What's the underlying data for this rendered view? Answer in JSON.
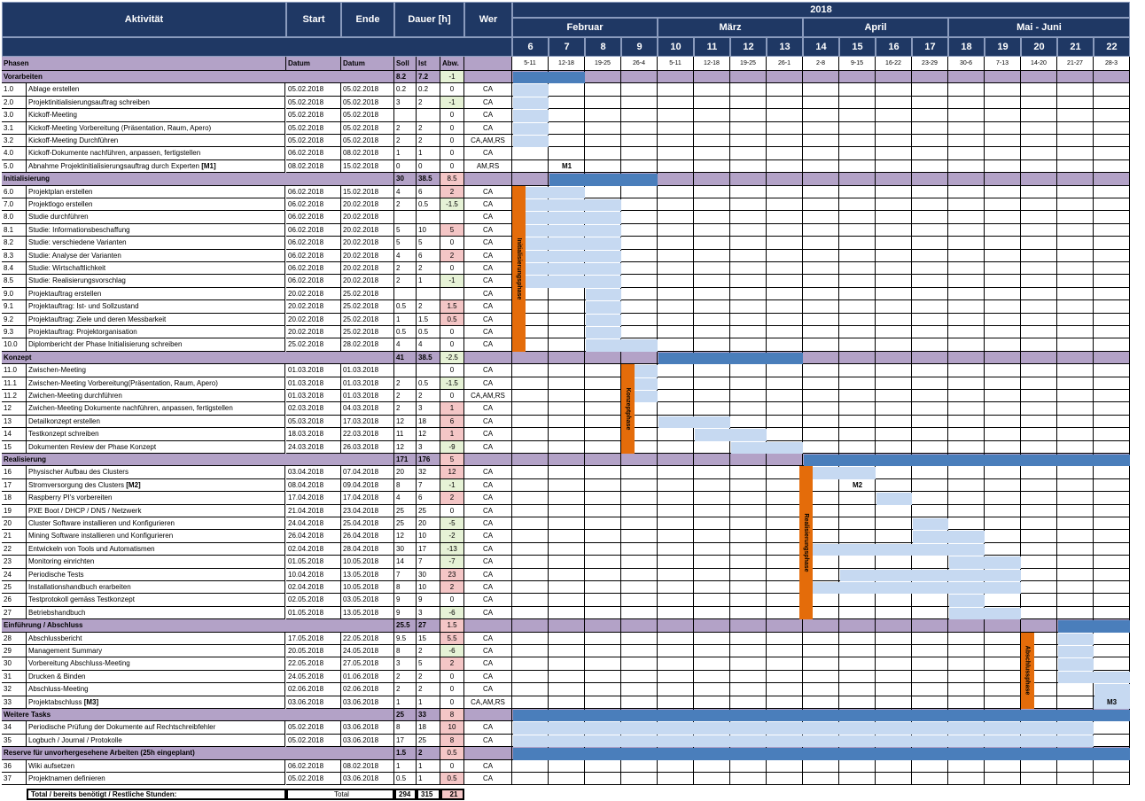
{
  "header": {
    "activity": "Aktivität",
    "start": "Start",
    "end": "Ende",
    "duration": "Dauer [h]",
    "who": "Wer",
    "year": "2018",
    "months": [
      {
        "label": "Februar",
        "start_week_index": 0,
        "span_weeks": 4
      },
      {
        "label": "März",
        "start_week_index": 4,
        "span_weeks": 4
      },
      {
        "label": "April",
        "start_week_index": 8,
        "span_weeks": 4
      },
      {
        "label": "Mai - Juni",
        "start_week_index": 12,
        "span_weeks": 5
      }
    ],
    "weeks": [
      "6",
      "7",
      "8",
      "9",
      "10",
      "11",
      "12",
      "13",
      "14",
      "15",
      "16",
      "17",
      "18",
      "19",
      "20",
      "21",
      "22"
    ],
    "ranges": [
      "5-11",
      "12-18",
      "19-25",
      "26-4",
      "5-11",
      "12-18",
      "19-25",
      "26-1",
      "2-8",
      "9-15",
      "16-22",
      "23-29",
      "30-6",
      "7-13",
      "14-20",
      "21-27",
      "28-3"
    ],
    "sub": {
      "phases": "Phasen",
      "datum": "Datum",
      "soll": "Soll",
      "ist": "Ist",
      "abw": "Abw."
    }
  },
  "colors": {
    "header_bg": "#1f3864",
    "phase_row": "#b3a2c7",
    "task_bar": "#c6d9f1",
    "phase_bar": "#4a7ebb",
    "phase_marker": "#e46c0a",
    "positive": "#e6f2d6",
    "negative": "#f4c6c6"
  },
  "rows": [
    {
      "kind": "phase",
      "name": "Vorarbeiten",
      "soll": "8.2",
      "ist": "7.2",
      "abw": "-1",
      "bar": [
        0,
        1
      ]
    },
    {
      "kind": "task",
      "no": "1.0",
      "name": "Ablage erstellen",
      "start": "05.02.2018",
      "end": "05.02.2018",
      "soll": "0.2",
      "ist": "0.2",
      "abw": "0",
      "who": "CA",
      "bar": [
        0,
        0
      ]
    },
    {
      "kind": "task",
      "no": "2.0",
      "name": "Projektinitialisierungsauftrag schreiben",
      "start": "05.02.2018",
      "end": "05.02.2018",
      "soll": "3",
      "ist": "2",
      "abw": "-1",
      "who": "CA",
      "bar": [
        0,
        0
      ]
    },
    {
      "kind": "task",
      "no": "3.0",
      "name": "Kickoff-Meeting",
      "start": "05.02.2018",
      "end": "05.02.2018",
      "soll": "",
      "ist": "",
      "abw": "0",
      "who": "CA",
      "bar": [
        0,
        0
      ]
    },
    {
      "kind": "task",
      "no": "3.1",
      "name": "Kickoff-Meeting Vorbereitung (Präsentation, Raum, Apero)",
      "start": "05.02.2018",
      "end": "05.02.2018",
      "soll": "2",
      "ist": "2",
      "abw": "0",
      "who": "CA",
      "bar": [
        0,
        0
      ]
    },
    {
      "kind": "task",
      "no": "3.2",
      "name": "Kickoff-Meeting Durchführen",
      "start": "05.02.2018",
      "end": "05.02.2018",
      "soll": "2",
      "ist": "2",
      "abw": "0",
      "who": "CA,AM,RS",
      "bar": [
        0,
        0
      ]
    },
    {
      "kind": "task",
      "no": "4.0",
      "name": "Kickoff-Dokumente nachführen, anpassen, fertigstellen",
      "start": "06.02.2018",
      "end": "08.02.2018",
      "soll": "1",
      "ist": "1",
      "abw": "0",
      "who": "CA"
    },
    {
      "kind": "task",
      "no": "5.0",
      "name": "Abnahme Projektinitialisierungsauftrag durch Experten",
      "tag": "[M1]",
      "start": "08.02.2018",
      "end": "15.02.2018",
      "soll": "0",
      "ist": "0",
      "abw": "0",
      "who": "AM,RS",
      "milestone": {
        "label": "M1",
        "week": 1
      }
    },
    {
      "kind": "phase",
      "name": "Initialisierung",
      "soll": "30",
      "ist": "38.5",
      "abw": "8.5",
      "bar": [
        1,
        3
      ]
    },
    {
      "kind": "task",
      "no": "6.0",
      "name": "Projektplan erstellen",
      "start": "06.02.2018",
      "end": "15.02.2018",
      "soll": "4",
      "ist": "6",
      "abw": "2",
      "who": "CA",
      "bar": [
        0,
        1
      ]
    },
    {
      "kind": "task",
      "no": "7.0",
      "name": "Projektlogo erstellen",
      "start": "06.02.2018",
      "end": "20.02.2018",
      "soll": "2",
      "ist": "0.5",
      "abw": "-1.5",
      "who": "CA",
      "bar": [
        0,
        2
      ]
    },
    {
      "kind": "task",
      "no": "8.0",
      "name": "Studie durchführen",
      "start": "06.02.2018",
      "end": "20.02.2018",
      "soll": "",
      "ist": "",
      "abw": "",
      "who": "CA",
      "bar": [
        0,
        2
      ]
    },
    {
      "kind": "task",
      "no": "8.1",
      "name": "Studie: Informationsbeschaffung",
      "start": "06.02.2018",
      "end": "20.02.2018",
      "soll": "5",
      "ist": "10",
      "abw": "5",
      "who": "CA",
      "bar": [
        0,
        2
      ]
    },
    {
      "kind": "task",
      "no": "8.2",
      "name": "Studie: verschiedene Varianten",
      "start": "06.02.2018",
      "end": "20.02.2018",
      "soll": "5",
      "ist": "5",
      "abw": "0",
      "who": "CA",
      "bar": [
        0,
        2
      ]
    },
    {
      "kind": "task",
      "no": "8.3",
      "name": "Studie: Analyse der Varianten",
      "start": "06.02.2018",
      "end": "20.02.2018",
      "soll": "4",
      "ist": "6",
      "abw": "2",
      "who": "CA",
      "bar": [
        0,
        2
      ]
    },
    {
      "kind": "task",
      "no": "8.4",
      "name": "Studie: Wirtschaftlichkeit",
      "start": "06.02.2018",
      "end": "20.02.2018",
      "soll": "2",
      "ist": "2",
      "abw": "0",
      "who": "CA",
      "bar": [
        0,
        2
      ]
    },
    {
      "kind": "task",
      "no": "8.5",
      "name": "Studie: Realisierungsvorschlag",
      "start": "06.02.2018",
      "end": "20.02.2018",
      "soll": "2",
      "ist": "1",
      "abw": "-1",
      "who": "CA",
      "bar": [
        0,
        2
      ]
    },
    {
      "kind": "task",
      "no": "9.0",
      "name": "Projektauftrag erstellen",
      "start": "20.02.2018",
      "end": "25.02.2018",
      "soll": "",
      "ist": "",
      "abw": "",
      "who": "CA",
      "bar": [
        2,
        2
      ]
    },
    {
      "kind": "task",
      "no": "9.1",
      "name": "Projektauftrag: Ist- und Sollzustand",
      "start": "20.02.2018",
      "end": "25.02.2018",
      "soll": "0.5",
      "ist": "2",
      "abw": "1.5",
      "who": "CA",
      "bar": [
        2,
        2
      ]
    },
    {
      "kind": "task",
      "no": "9.2",
      "name": "Projektauftrag: Ziele und deren Messbarkeit",
      "start": "20.02.2018",
      "end": "25.02.2018",
      "soll": "1",
      "ist": "1.5",
      "abw": "0.5",
      "who": "CA",
      "bar": [
        2,
        2
      ]
    },
    {
      "kind": "task",
      "no": "9.3",
      "name": "Projektauftrag: Projektorganisation",
      "start": "20.02.2018",
      "end": "25.02.2018",
      "soll": "0.5",
      "ist": "0.5",
      "abw": "0",
      "who": "CA",
      "bar": [
        2,
        2
      ]
    },
    {
      "kind": "task",
      "no": "10.0",
      "name": "Diplombericht der Phase Initialisierung schreiben",
      "start": "25.02.2018",
      "end": "28.02.2018",
      "soll": "4",
      "ist": "4",
      "abw": "0",
      "who": "CA",
      "bar": [
        2,
        3
      ]
    },
    {
      "kind": "phase",
      "name": "Konzept",
      "soll": "41",
      "ist": "38.5",
      "abw": "-2.5",
      "bar": [
        4,
        7
      ]
    },
    {
      "kind": "task",
      "no": "11.0",
      "name": "Zwischen-Meeting",
      "start": "01.03.2018",
      "end": "01.03.2018",
      "soll": "",
      "ist": "",
      "abw": "0",
      "who": "CA",
      "bar": [
        3,
        3
      ]
    },
    {
      "kind": "task",
      "no": "11.1",
      "name": "Zwischen-Meeting Vorbereitung(Präsentation, Raum, Apero)",
      "start": "01.03.2018",
      "end": "01.03.2018",
      "soll": "2",
      "ist": "0.5",
      "abw": "-1.5",
      "who": "CA",
      "bar": [
        3,
        3
      ]
    },
    {
      "kind": "task",
      "no": "11.2",
      "name": "Zwichen-Meeting durchführen",
      "start": "01.03.2018",
      "end": "01.03.2018",
      "soll": "2",
      "ist": "2",
      "abw": "0",
      "who": "CA,AM,RS",
      "bar": [
        3,
        3
      ]
    },
    {
      "kind": "task",
      "no": "12",
      "name": "Zwichen-Meeting Dokumente nachführen, anpassen, fertigstellen",
      "start": "02.03.2018",
      "end": "04.03.2018",
      "soll": "2",
      "ist": "3",
      "abw": "1",
      "who": "CA"
    },
    {
      "kind": "task",
      "no": "13",
      "name": "Detailkonzept erstellen",
      "start": "05.03.2018",
      "end": "17.03.2018",
      "soll": "12",
      "ist": "18",
      "abw": "6",
      "who": "CA",
      "bar": [
        4,
        5
      ]
    },
    {
      "kind": "task",
      "no": "14",
      "name": "Testkonzept schreiben",
      "start": "18.03.2018",
      "end": "22.03.2018",
      "soll": "11",
      "ist": "12",
      "abw": "1",
      "who": "CA",
      "bar": [
        5,
        6
      ]
    },
    {
      "kind": "task",
      "no": "15",
      "name": "Dokumenten Review der Phase Konzept",
      "start": "24.03.2018",
      "end": "26.03.2018",
      "soll": "12",
      "ist": "3",
      "abw": "-9",
      "who": "CA",
      "bar": [
        6,
        7
      ]
    },
    {
      "kind": "phase",
      "name": "Realisierung",
      "soll": "171",
      "ist": "176",
      "abw": "5",
      "bar": [
        8,
        16
      ]
    },
    {
      "kind": "task",
      "no": "16",
      "name": "Physischer Aufbau des Clusters",
      "start": "03.04.2018",
      "end": "07.04.2018",
      "soll": "20",
      "ist": "32",
      "abw": "12",
      "who": "CA",
      "bar": [
        8,
        9
      ]
    },
    {
      "kind": "task",
      "no": "17",
      "name": "Stromversorgung des Clusters",
      "tag": "[M2]",
      "start": "08.04.2018",
      "end": "09.04.2018",
      "soll": "8",
      "ist": "7",
      "abw": "-1",
      "who": "CA",
      "milestone": {
        "label": "M2",
        "week": 9
      }
    },
    {
      "kind": "task",
      "no": "18",
      "name": "Raspberry PI's vorbereiten",
      "start": "17.04.2018",
      "end": "17.04.2018",
      "soll": "4",
      "ist": "6",
      "abw": "2",
      "who": "CA",
      "bar": [
        10,
        10
      ]
    },
    {
      "kind": "task",
      "no": "19",
      "name": "PXE Boot / DHCP  / DNS / Netzwerk",
      "start": "21.04.2018",
      "end": "23.04.2018",
      "soll": "25",
      "ist": "25",
      "abw": "0",
      "who": "CA"
    },
    {
      "kind": "task",
      "no": "20",
      "name": "Cluster Software installieren und Konfigurieren",
      "start": "24.04.2018",
      "end": "25.04.2018",
      "soll": "25",
      "ist": "20",
      "abw": "-5",
      "who": "CA",
      "bar": [
        11,
        11
      ]
    },
    {
      "kind": "task",
      "no": "21",
      "name": "Mining Software installieren und Konfigurieren",
      "start": "26.04.2018",
      "end": "26.04.2018",
      "soll": "12",
      "ist": "10",
      "abw": "-2",
      "who": "CA",
      "bar": [
        11,
        12
      ]
    },
    {
      "kind": "task",
      "no": "22",
      "name": "Entwickeln von Tools und Automatismen",
      "start": "02.04.2018",
      "end": "28.04.2018",
      "soll": "30",
      "ist": "17",
      "abw": "-13",
      "who": "CA",
      "bar": [
        8,
        12
      ]
    },
    {
      "kind": "task",
      "no": "23",
      "name": "Monitoring einrichten",
      "start": "01.05.2018",
      "end": "10.05.2018",
      "soll": "14",
      "ist": "7",
      "abw": "-7",
      "who": "CA",
      "bar": [
        12,
        13
      ]
    },
    {
      "kind": "task",
      "no": "24",
      "name": "Periodische Tests",
      "start": "10.04.2018",
      "end": "13.05.2018",
      "soll": "7",
      "ist": "30",
      "abw": "23",
      "who": "CA",
      "bar": [
        9,
        13
      ]
    },
    {
      "kind": "task",
      "no": "25",
      "name": "Installationshandbuch erarbeiten",
      "start": "02.04.2018",
      "end": "10.05.2018",
      "soll": "8",
      "ist": "10",
      "abw": "2",
      "who": "CA",
      "bar": [
        8,
        13
      ]
    },
    {
      "kind": "task",
      "no": "26",
      "name": "Testprotokoll gemäss Testkonzept",
      "start": "02.05.2018",
      "end": "03.05.2018",
      "soll": "9",
      "ist": "9",
      "abw": "0",
      "who": "CA",
      "bar": [
        12,
        12
      ]
    },
    {
      "kind": "task",
      "no": "27",
      "name": "Betriebshandbuch",
      "start": "01.05.2018",
      "end": "13.05.2018",
      "soll": "9",
      "ist": "3",
      "abw": "-6",
      "who": "CA",
      "bar": [
        12,
        13
      ]
    },
    {
      "kind": "phase",
      "name": "Einführung / Abschluss",
      "soll": "25.5",
      "ist": "27",
      "abw": "1.5",
      "bar": [
        15,
        16
      ]
    },
    {
      "kind": "task",
      "no": "28",
      "name": "Abschlussbericht",
      "start": "17.05.2018",
      "end": "22.05.2018",
      "soll": "9.5",
      "ist": "15",
      "abw": "5.5",
      "who": "CA",
      "bar": [
        15,
        15
      ]
    },
    {
      "kind": "task",
      "no": "29",
      "name": "Management Summary",
      "start": "20.05.2018",
      "end": "24.05.2018",
      "soll": "8",
      "ist": "2",
      "abw": "-6",
      "who": "CA",
      "bar": [
        15,
        15
      ]
    },
    {
      "kind": "task",
      "no": "30",
      "name": "Vorbereitung Abschluss-Meeting",
      "start": "22.05.2018",
      "end": "27.05.2018",
      "soll": "3",
      "ist": "5",
      "abw": "2",
      "who": "CA",
      "bar": [
        15,
        15
      ]
    },
    {
      "kind": "task",
      "no": "31",
      "name": "Drucken & Binden",
      "start": "24.05.2018",
      "end": "01.06.2018",
      "soll": "2",
      "ist": "2",
      "abw": "0",
      "who": "CA",
      "bar": [
        15,
        16
      ]
    },
    {
      "kind": "task",
      "no": "32",
      "name": "Abschluss-Meeting",
      "start": "02.06.2018",
      "end": "02.06.2018",
      "soll": "2",
      "ist": "2",
      "abw": "0",
      "who": "CA",
      "bar": [
        16,
        16
      ]
    },
    {
      "kind": "task",
      "no": "33",
      "name": "Projektabschluss",
      "tag": "[M3]",
      "start": "03.06.2018",
      "end": "03.06.2018",
      "soll": "1",
      "ist": "1",
      "abw": "0",
      "who": "CA,AM,RS",
      "milestone": {
        "label": "M3",
        "week": 16
      }
    },
    {
      "kind": "phase",
      "name": "Weitere Tasks",
      "soll": "25",
      "ist": "33",
      "abw": "8",
      "bar": [
        0,
        16
      ]
    },
    {
      "kind": "task",
      "no": "34",
      "name": "Periodische Prüfung der Dokumente auf Rechtschreibfehler",
      "start": "05.02.2018",
      "end": "03.06.2018",
      "soll": "8",
      "ist": "18",
      "abw": "10",
      "who": "CA",
      "bar": [
        0,
        15
      ]
    },
    {
      "kind": "task",
      "no": "35",
      "name": "Logbuch / Journal / Protokolle",
      "start": "05.02.2018",
      "end": "03.06.2018",
      "soll": "17",
      "ist": "25",
      "abw": "8",
      "who": "CA",
      "bar": [
        0,
        15
      ]
    },
    {
      "kind": "phase",
      "name": "Reserve für unvorhergesehene Arbeiten (25h eingeplant)",
      "soll": "1.5",
      "ist": "2",
      "abw": "0.5",
      "bar": [
        0,
        16
      ]
    },
    {
      "kind": "task",
      "no": "36",
      "name": "Wiki aufsetzen",
      "start": "06.02.2018",
      "end": "08.02.2018",
      "soll": "1",
      "ist": "1",
      "abw": "0",
      "who": "CA"
    },
    {
      "kind": "task",
      "no": "37",
      "name": "Projektnamen definieren",
      "start": "05.02.2018",
      "end": "03.06.2018",
      "soll": "0.5",
      "ist": "1",
      "abw": "0.5",
      "who": "CA"
    }
  ],
  "phase_markers": [
    {
      "label": "Initialisierungsphase",
      "first_row": 9,
      "last_row": 21
    },
    {
      "label": "Konzeptphase",
      "first_row": 23,
      "last_row": 29
    },
    {
      "label": "Realisierungsphase",
      "first_row": 31,
      "last_row": 42
    },
    {
      "label": "Abschlussphase",
      "first_row": 44,
      "last_row": 49
    }
  ],
  "total": {
    "label": "Total / bereits benötigt / Restliche Stunden:",
    "total_word": "Total",
    "soll": "294",
    "ist": "315",
    "abw": "21"
  }
}
